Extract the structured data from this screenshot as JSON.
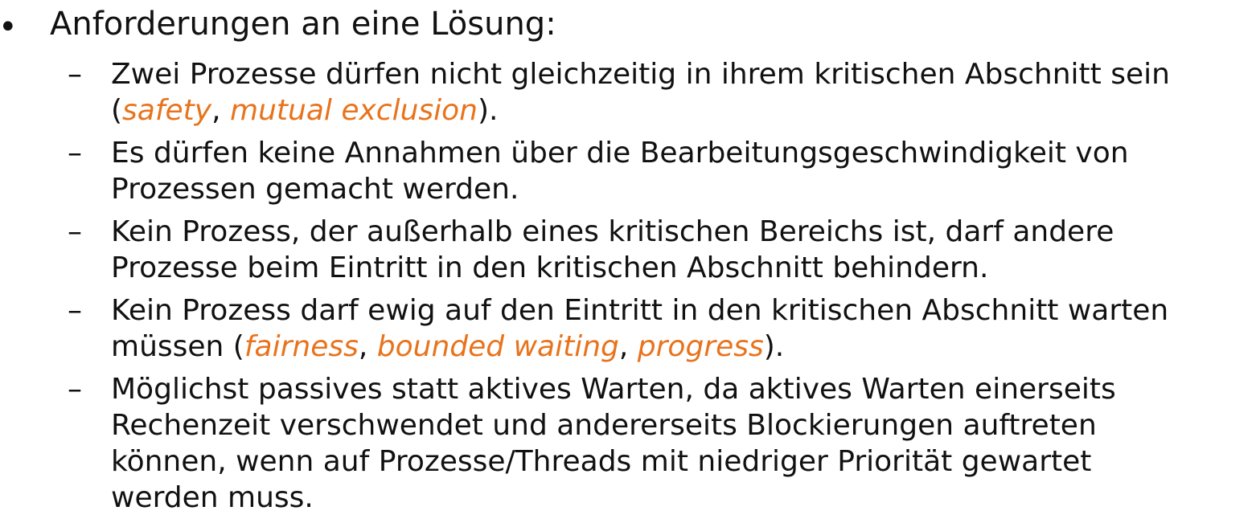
{
  "heading": {
    "bullet": "•",
    "text": "Anforderungen an eine Lösung:"
  },
  "colors": {
    "text": "#111111",
    "highlight": "#e8731c"
  },
  "items": [
    {
      "dash": "–",
      "line1": "Zwei Prozesse dürfen nicht gleichzeitig in ihrem kritischen Abschnitt sein",
      "line2_open": "(",
      "term1": "safety",
      "sep1": ", ",
      "term2": "mutual exclusion",
      "line2_close": ")."
    },
    {
      "dash": "–",
      "line1": "Es dürfen keine Annahmen über die Bearbeitungsgeschwindigkeit von",
      "line2": "Prozessen gemacht werden."
    },
    {
      "dash": "–",
      "line1": "Kein Prozess, der außerhalb eines kritischen Bereichs ist, darf andere",
      "line2": "Prozesse beim Eintritt in den kritischen Abschnitt behindern."
    },
    {
      "dash": "–",
      "line1": "Kein Prozess darf ewig auf den Eintritt in den kritischen Abschnitt warten",
      "line2_open": "müssen (",
      "term1": "fairness",
      "sep1": ", ",
      "term2": "bounded waiting",
      "sep2": ", ",
      "term3": "progress",
      "line2_close": ")."
    },
    {
      "dash": "–",
      "line1": "Möglichst passives statt aktives Warten, da aktives Warten einerseits",
      "line2": "Rechenzeit verschwendet und andererseits Blockierungen auftreten",
      "line3": "können, wenn auf Prozesse/Threads mit niedriger Priorität gewartet",
      "line4": "werden muss."
    }
  ]
}
